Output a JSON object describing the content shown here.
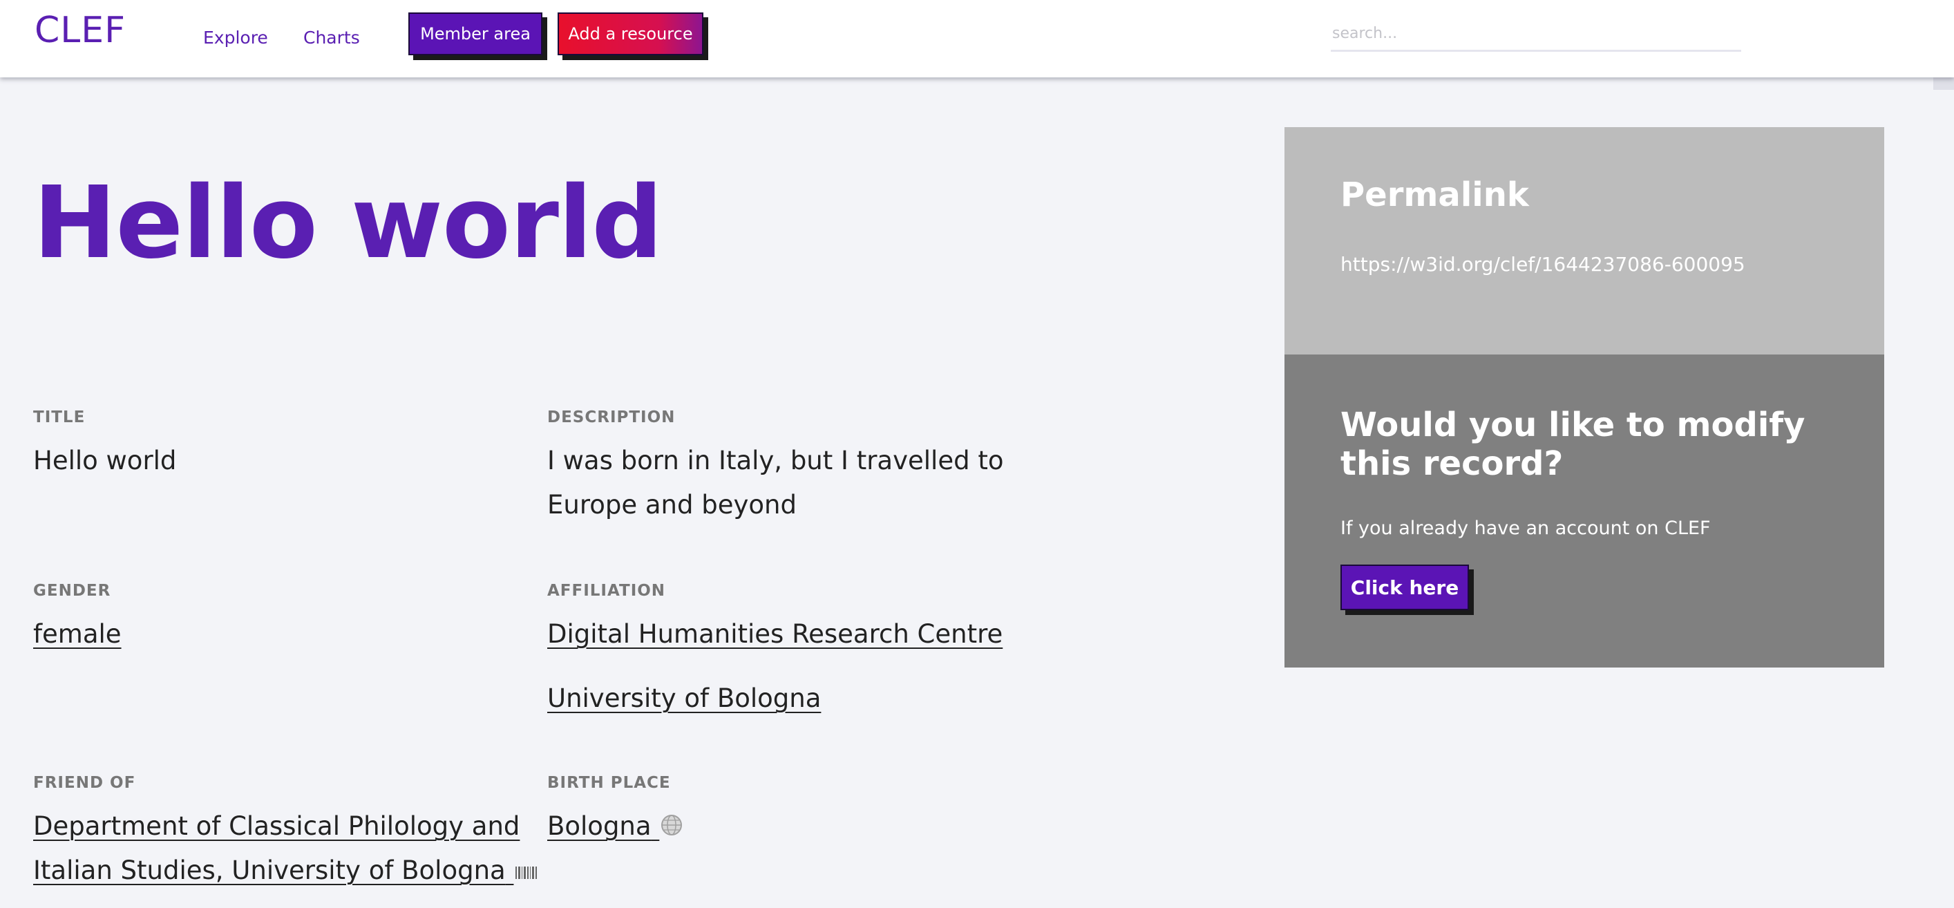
{
  "header": {
    "logo": "CLEF",
    "nav": [
      "Explore",
      "Charts"
    ],
    "member_button": "Member area",
    "add_button": "Add a resource",
    "search_placeholder": "search..."
  },
  "record": {
    "title": "Hello world",
    "fields": {
      "title": {
        "label": "TITLE",
        "value": "Hello world"
      },
      "description": {
        "label": "DESCRIPTION",
        "lines": [
          "I was born in Italy, but I travelled to",
          "Europe and beyond"
        ]
      },
      "gender": {
        "label": "GENDER",
        "value": "female"
      },
      "affiliation": {
        "label": "AFFILIATION",
        "values": [
          "Digital Humanities Research Centre",
          "University of Bologna"
        ]
      },
      "friend_of": {
        "label": "FRIEND OF",
        "lines": [
          "Department of Classical Philology and",
          "Italian Studies, University of Bologna"
        ],
        "icon": "barcode-icon"
      },
      "birth_place": {
        "label": "BIRTH PLACE",
        "value": "Bologna",
        "icon": "globe-icon"
      }
    }
  },
  "sidebar": {
    "permalink_title": "Permalink",
    "permalink_url": "https://w3id.org/clef/1644237086-600095",
    "modify_title": "Would you like to modify this record?",
    "modify_text": "If you already have an account on CLEF",
    "modify_button": "Click here"
  },
  "colors": {
    "brand": "#5a1fb2",
    "accent_red": "#e8102c",
    "permalink_bg": "#bcbcbc",
    "modify_bg": "#808080",
    "page_bg": "#f3f4f8"
  }
}
